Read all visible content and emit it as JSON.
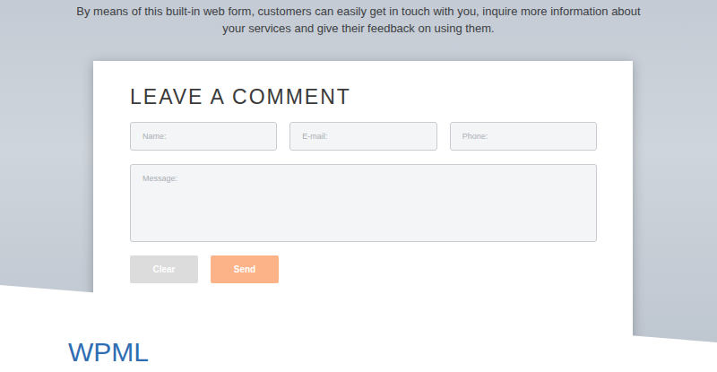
{
  "intro": [
    "By means of this built-in web form, customers can easily get in touch with you, inquire more information about",
    "your services and give their feedback on using them."
  ],
  "form": {
    "title": "LEAVE A COMMENT",
    "fields": [
      {
        "placeholder": "Name:"
      },
      {
        "placeholder": "E-mail:"
      },
      {
        "placeholder": "Phone:"
      }
    ],
    "message": {
      "placeholder": "Message:"
    },
    "buttons": [
      {
        "label": "Clear",
        "kind": "secondary"
      },
      {
        "label": "Send",
        "kind": "primary"
      }
    ]
  },
  "next_section": {
    "title": "WPML"
  }
}
